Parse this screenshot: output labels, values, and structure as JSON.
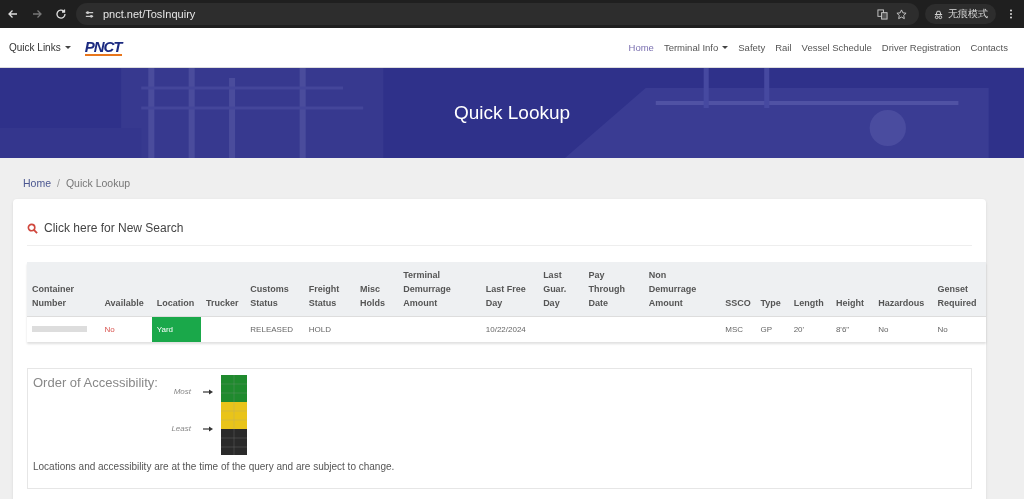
{
  "browser": {
    "url": "pnct.net/TosInquiry",
    "profile": "无痕模式"
  },
  "navbar": {
    "quick_links": "Quick Links",
    "logo": "PNCT",
    "items": [
      {
        "label": "Home",
        "selected": true,
        "dropdown": false
      },
      {
        "label": "Terminal Info",
        "selected": false,
        "dropdown": true
      },
      {
        "label": "Safety",
        "selected": false,
        "dropdown": false
      },
      {
        "label": "Rail",
        "selected": false,
        "dropdown": false
      },
      {
        "label": "Vessel Schedule",
        "selected": false,
        "dropdown": false
      },
      {
        "label": "Driver Registration",
        "selected": false,
        "dropdown": false
      },
      {
        "label": "Contacts",
        "selected": false,
        "dropdown": false
      }
    ]
  },
  "banner": {
    "title": "Quick Lookup"
  },
  "breadcrumb": {
    "separator": "/",
    "items": [
      {
        "label": "Home",
        "link": true
      },
      {
        "label": "Quick Lookup",
        "link": false
      }
    ]
  },
  "new_search": "Click here for New Search",
  "table": {
    "columns": [
      "Container Number",
      "Available",
      "Location",
      "Trucker",
      "Customs Status",
      "Freight Status",
      "Misc Holds",
      "Terminal Demurrage Amount",
      "Last Free Day",
      "Last Guar. Day",
      "Pay Through Date",
      "Non Demurrage Amount",
      "SSCO",
      "Type",
      "Length",
      "Height",
      "Hazardous",
      "Genset Required"
    ],
    "rows": [
      {
        "cells": [
          {
            "kind": "redacted"
          },
          {
            "kind": "text",
            "text": "No",
            "warning": true,
            "highlighted": false
          },
          {
            "kind": "text",
            "text": "Yard",
            "warning": false,
            "highlighted": true
          },
          {
            "kind": "empty"
          },
          {
            "kind": "text",
            "text": "RELEASED",
            "warning": false,
            "highlighted": false
          },
          {
            "kind": "text",
            "text": "HOLD",
            "warning": false,
            "highlighted": false
          },
          {
            "kind": "empty"
          },
          {
            "kind": "empty"
          },
          {
            "kind": "text",
            "text": "10/22/2024",
            "warning": false,
            "highlighted": false
          },
          {
            "kind": "empty"
          },
          {
            "kind": "empty"
          },
          {
            "kind": "empty"
          },
          {
            "kind": "text",
            "text": "MSC",
            "warning": false,
            "highlighted": false
          },
          {
            "kind": "text",
            "text": "GP",
            "warning": false,
            "highlighted": false
          },
          {
            "kind": "text",
            "text": "20'",
            "warning": false,
            "highlighted": false
          },
          {
            "kind": "text",
            "text": "8'6\"",
            "warning": false,
            "highlighted": false
          },
          {
            "kind": "text",
            "text": "No",
            "warning": false,
            "highlighted": false
          },
          {
            "kind": "text",
            "text": "No",
            "warning": false,
            "highlighted": false
          }
        ]
      }
    ]
  },
  "accessibility": {
    "title": "Order of Accessibility:",
    "most": "Most",
    "least": "Least",
    "note": "Locations and accessibility are at the time of the query and are subject to change."
  }
}
